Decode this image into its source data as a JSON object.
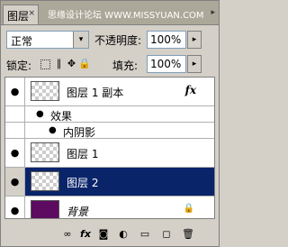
{
  "panel": {
    "tab_label": "图层",
    "tab_close": "×",
    "watermark": "思缘设计论坛 WWW.MISSYUAN.COM",
    "menu_arrow": "▸"
  },
  "controls": {
    "blend_mode": "正常",
    "blend_arrow": "▾",
    "opacity_label": "不透明度:",
    "opacity_value": "100%",
    "slider_arrow": "▸",
    "lock_label": "锁定:",
    "fill_label": "填充:",
    "fill_value": "100%"
  },
  "icons": {
    "eye": "●",
    "lock_transparent": "",
    "lock_brush": "∥",
    "lock_move": "✥",
    "lock_all": "🔒",
    "fx": "fx",
    "layer_lock": "🔒"
  },
  "layers": [
    {
      "name": "图层 1 副本",
      "has_fx": true
    },
    {
      "effects_label": "效果"
    },
    {
      "effect_name": "内阴影"
    },
    {
      "name": "图层 1"
    },
    {
      "name": "图层 2",
      "selected": true
    },
    {
      "name": "背景",
      "locked": true
    }
  ],
  "bottom_icons": {
    "link": "∞",
    "fx": "fx",
    "mask": "◙",
    "adjust": "◐",
    "group": "▭",
    "new": "◻",
    "trash": "🗑"
  },
  "colors": {
    "selected": "#0a246a",
    "background_layer": "#5c0b60"
  }
}
